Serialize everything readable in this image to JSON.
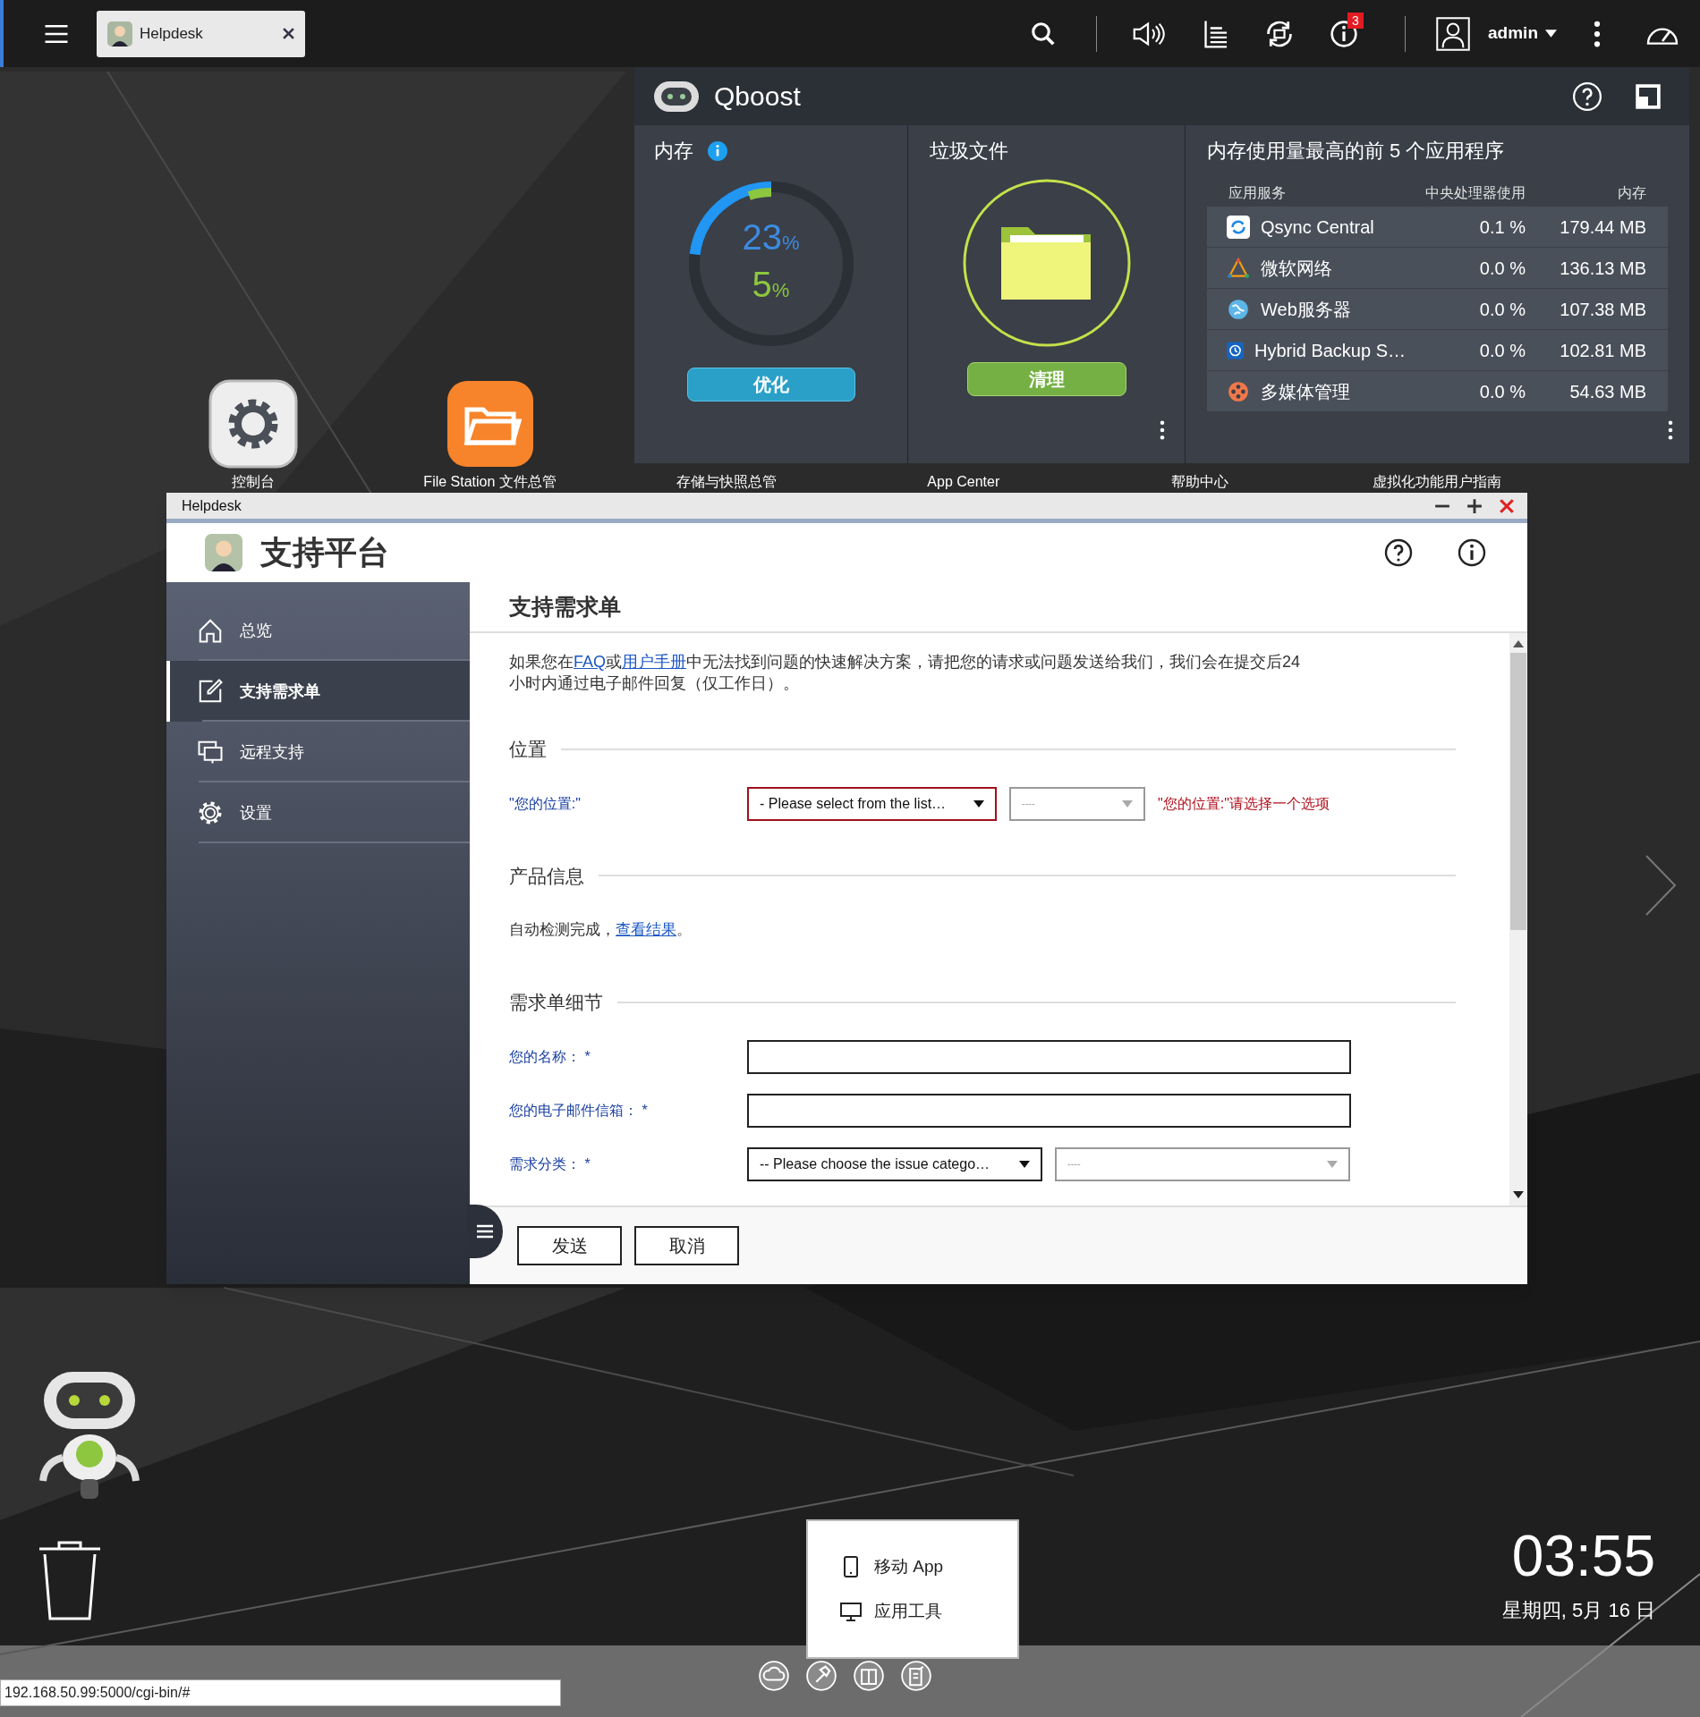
{
  "top_bar": {
    "tabs": [
      {
        "label": "Helpdesk",
        "selected": true
      }
    ],
    "notification_count": "3",
    "user": "admin"
  },
  "qboost": {
    "title": "Qboost",
    "memory": {
      "title": "内存",
      "ram": {
        "value": "23",
        "unit": "%",
        "level": 0.23
      },
      "cpu": {
        "value": "5",
        "unit": "%",
        "level": 0.05
      },
      "button": "优化"
    },
    "junk": {
      "title": "垃圾文件",
      "button": "清理"
    },
    "top_apps": {
      "title": "内存使用量最高的前 5 个应用程序",
      "columns": [
        "应用服务",
        "中央处理器使用",
        "内存"
      ],
      "rows": [
        {
          "kind": "sync",
          "name": "Qsync Central",
          "cpu": "0.1 %",
          "memory": "179.44 MB"
        },
        {
          "kind": "triangle",
          "name": "微软网络",
          "cpu": "0.0 %",
          "memory": "136.13 MB"
        },
        {
          "kind": "globe",
          "name": "Web服务器",
          "cpu": "0.0 %",
          "memory": "107.38 MB"
        },
        {
          "kind": "clock",
          "name": "Hybrid Backup S…",
          "cpu": "0.0 %",
          "memory": "102.81 MB"
        },
        {
          "kind": "film",
          "name": "多媒体管理",
          "cpu": "0.0 %",
          "memory": "54.63 MB"
        }
      ]
    }
  },
  "desktop_icons": [
    {
      "label": "控制台",
      "kind": "gear"
    },
    {
      "label": "File Station 文件总管",
      "kind": "folder"
    },
    {
      "label": "存储与快照总管",
      "kind": "covered"
    },
    {
      "label": "App Center",
      "kind": "covered"
    },
    {
      "label": "帮助中心",
      "kind": "covered"
    },
    {
      "label": "虚拟化功能用户指南",
      "kind": "covered"
    }
  ],
  "helpdesk": {
    "window_title": "Helpdesk",
    "app_title": "支持平台",
    "sidebar": [
      {
        "label": "总览",
        "kind": "home",
        "selected": false
      },
      {
        "label": "支持需求单",
        "kind": "edit",
        "selected": true
      },
      {
        "label": "远程支持",
        "kind": "screens",
        "selected": false
      },
      {
        "label": "设置",
        "kind": "gear",
        "selected": false
      }
    ],
    "page_title": "支持需求单",
    "intro": [
      {
        "text": "如果您在"
      },
      {
        "text": "FAQ",
        "link": true
      },
      {
        "text": "或"
      },
      {
        "text": "用户手册",
        "link": true
      },
      {
        "text": "中无法找到问题的快速解决方案，请把您的请求或问题发送给我们，我们会在提交后24 小时内通过电子邮件回复（仅工作日）。"
      }
    ],
    "sections": [
      {
        "heading": "位置",
        "rows": [
          {
            "kind": "select",
            "label": "\"您的位置:\"",
            "selects": [
              {
                "value": "- Please select from the list…",
                "error": true,
                "disabled": false
              },
              {
                "value": "----",
                "error": false,
                "disabled": true
              }
            ],
            "error": "\"您的位置:\"请选择一个选项"
          }
        ]
      },
      {
        "heading": "产品信息",
        "rows": [
          {
            "kind": "note",
            "parts": [
              {
                "text": "自动检测完成，"
              },
              {
                "text": "查看结果",
                "link": true
              },
              {
                "text": "。"
              }
            ]
          }
        ]
      },
      {
        "heading": "需求单细节",
        "rows": [
          {
            "kind": "input",
            "label": "您的名称：  *"
          },
          {
            "kind": "input",
            "label": "您的电子邮件信箱：  *"
          },
          {
            "kind": "select",
            "label": "需求分类：  *",
            "selects": [
              {
                "value": "-- Please choose the issue catego…",
                "error": false,
                "disabled": false
              },
              {
                "value": "----",
                "error": false,
                "disabled": true
              }
            ]
          }
        ]
      }
    ],
    "buttons": [
      "发送",
      "取消"
    ]
  },
  "popup_menu": [
    {
      "label": "移动 App",
      "kind": "phone"
    },
    {
      "label": "应用工具",
      "kind": "monitor"
    }
  ],
  "clock": {
    "time": "03:55",
    "date": "星期四, 5月 16 日"
  },
  "status_url": "192.168.50.99:5000/cgi-bin/#"
}
